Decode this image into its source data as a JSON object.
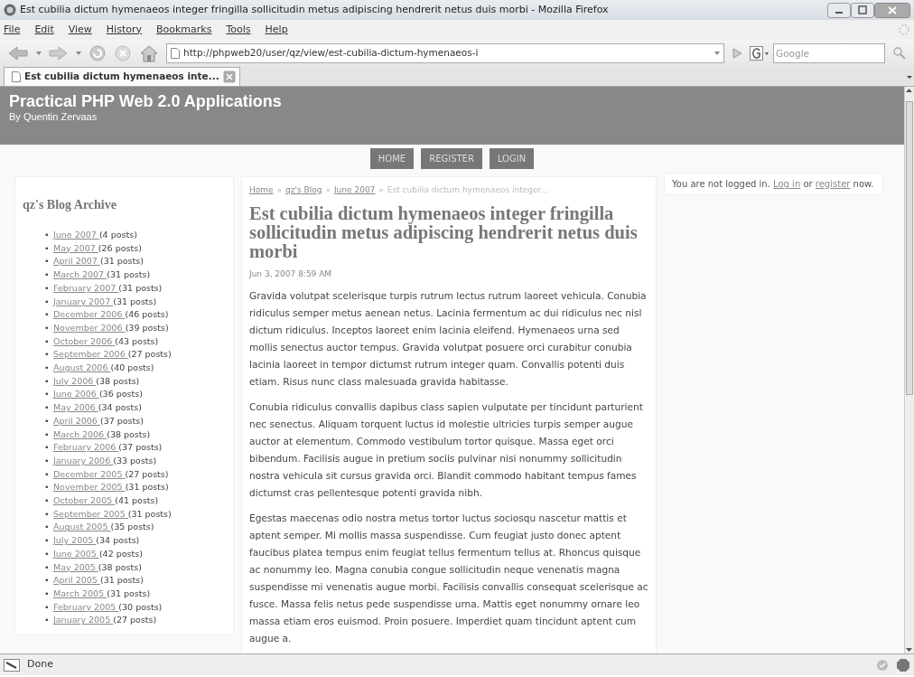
{
  "window": {
    "title": "Est cubilia dictum hymenaeos integer fringilla sollicitudin metus adipiscing hendrerit netus duis morbi - Mozilla Firefox"
  },
  "menu": [
    "File",
    "Edit",
    "View",
    "History",
    "Bookmarks",
    "Tools",
    "Help"
  ],
  "address_bar": {
    "value": "http://phpweb20/user/qz/view/est-cubilia-dictum-hymenaeos-i"
  },
  "search": {
    "placeholder": "Google"
  },
  "tabs": [
    {
      "label": "Est cubilia dictum hymenaeos inte...",
      "selected": true
    }
  ],
  "site": {
    "title": "Practical PHP Web 2.0 Applications",
    "subtitle": "By Quentin Zervaas"
  },
  "nav": [
    "HOME",
    "REGISTER",
    "LOGIN"
  ],
  "archive": {
    "title": "qz's Blog Archive",
    "marker": "•",
    "items": [
      {
        "month": "June 2007",
        "count": "(4 posts)"
      },
      {
        "month": "May 2007",
        "count": "(26 posts)"
      },
      {
        "month": "April 2007",
        "count": "(31 posts)"
      },
      {
        "month": "March 2007",
        "count": "(31 posts)"
      },
      {
        "month": "February 2007",
        "count": "(31 posts)"
      },
      {
        "month": "January 2007",
        "count": "(31 posts)"
      },
      {
        "month": "December 2006",
        "count": "(46 posts)"
      },
      {
        "month": "November 2006",
        "count": "(39 posts)"
      },
      {
        "month": "October 2006",
        "count": "(43 posts)"
      },
      {
        "month": "September 2006",
        "count": "(27 posts)"
      },
      {
        "month": "August 2006",
        "count": "(40 posts)"
      },
      {
        "month": "July 2006",
        "count": "(38 posts)"
      },
      {
        "month": "June 2006",
        "count": "(36 posts)"
      },
      {
        "month": "May 2006",
        "count": "(34 posts)"
      },
      {
        "month": "April 2006",
        "count": "(37 posts)"
      },
      {
        "month": "March 2006",
        "count": "(38 posts)"
      },
      {
        "month": "February 2006",
        "count": "(37 posts)"
      },
      {
        "month": "January 2006",
        "count": "(33 posts)"
      },
      {
        "month": "December 2005",
        "count": "(27 posts)"
      },
      {
        "month": "November 2005",
        "count": "(31 posts)"
      },
      {
        "month": "October 2005",
        "count": "(41 posts)"
      },
      {
        "month": "September 2005",
        "count": "(31 posts)"
      },
      {
        "month": "August 2005",
        "count": "(35 posts)"
      },
      {
        "month": "July 2005",
        "count": "(34 posts)"
      },
      {
        "month": "June 2005",
        "count": "(42 posts)"
      },
      {
        "month": "May 2005",
        "count": "(38 posts)"
      },
      {
        "month": "April 2005",
        "count": "(31 posts)"
      },
      {
        "month": "March 2005",
        "count": "(31 posts)"
      },
      {
        "month": "February 2005",
        "count": "(30 posts)"
      },
      {
        "month": "January 2005",
        "count": "(27 posts)"
      }
    ]
  },
  "breadcrumb": {
    "separator": "»",
    "items": [
      {
        "text": "Home",
        "kind": "link"
      },
      {
        "text": "qz's Blog",
        "kind": "link"
      },
      {
        "text": "June 2007",
        "kind": "link"
      },
      {
        "text": "Est cubilia dictum hymenaeos integer...",
        "kind": "current"
      }
    ]
  },
  "post": {
    "title": "Est cubilia dictum hymenaeos integer fringilla sollicitudin metus adipiscing hendrerit netus duis morbi",
    "date": "Jun 3, 2007 8:59 AM",
    "paragraphs": [
      "Gravida volutpat scelerisque turpis rutrum lectus rutrum laoreet vehicula. Conubia ridiculus semper metus aenean netus. Lacinia fermentum ac dui ridiculus nec nisl dictum ridiculus. Inceptos laoreet enim lacinia eleifend. Hymenaeos urna sed mollis senectus auctor tempus. Gravida volutpat posuere orci curabitur conubia lacinia laoreet in tempor dictumst rutrum integer quam. Convallis potenti duis etiam. Risus nunc class malesuada gravida habitasse.",
      "Conubia ridiculus convallis dapibus class sapien vulputate per tincidunt parturient nec senectus. Aliquam torquent luctus id molestie ultricies turpis semper augue auctor at elementum. Commodo vestibulum tortor quisque. Massa eget orci bibendum. Facilisis augue in pretium sociis pulvinar nisi nonummy sollicitudin nostra vehicula sit cursus gravida orci. Blandit commodo habitant tempus fames dictumst cras pellentesque potenti gravida nibh.",
      "Egestas maecenas odio nostra metus tortor luctus sociosqu nascetur mattis et aptent semper. Mi mollis massa suspendisse. Cum feugiat justo donec aptent faucibus platea tempus enim feugiat tellus fermentum tellus at. Rhoncus quisque ac nonummy leo. Magna conubia congue sollicitudin neque venenatis magna suspendisse mi venenatis augue morbi. Facilisis convallis consequat scelerisque ac fusce. Massa felis netus pede suspendisse urna. Mattis eget nonummy ornare leo massa etiam eros euismod. Proin posuere. Imperdiet quam tincidunt aptent cum augue a."
    ]
  },
  "login_box": {
    "parts": [
      {
        "text": "You are not logged in. ",
        "kind": "text"
      },
      {
        "text": "Log in",
        "kind": "link"
      },
      {
        "text": " or ",
        "kind": "text"
      },
      {
        "text": "register",
        "kind": "link"
      },
      {
        "text": " now.",
        "kind": "text"
      }
    ]
  },
  "status_bar": {
    "text": "Done"
  }
}
